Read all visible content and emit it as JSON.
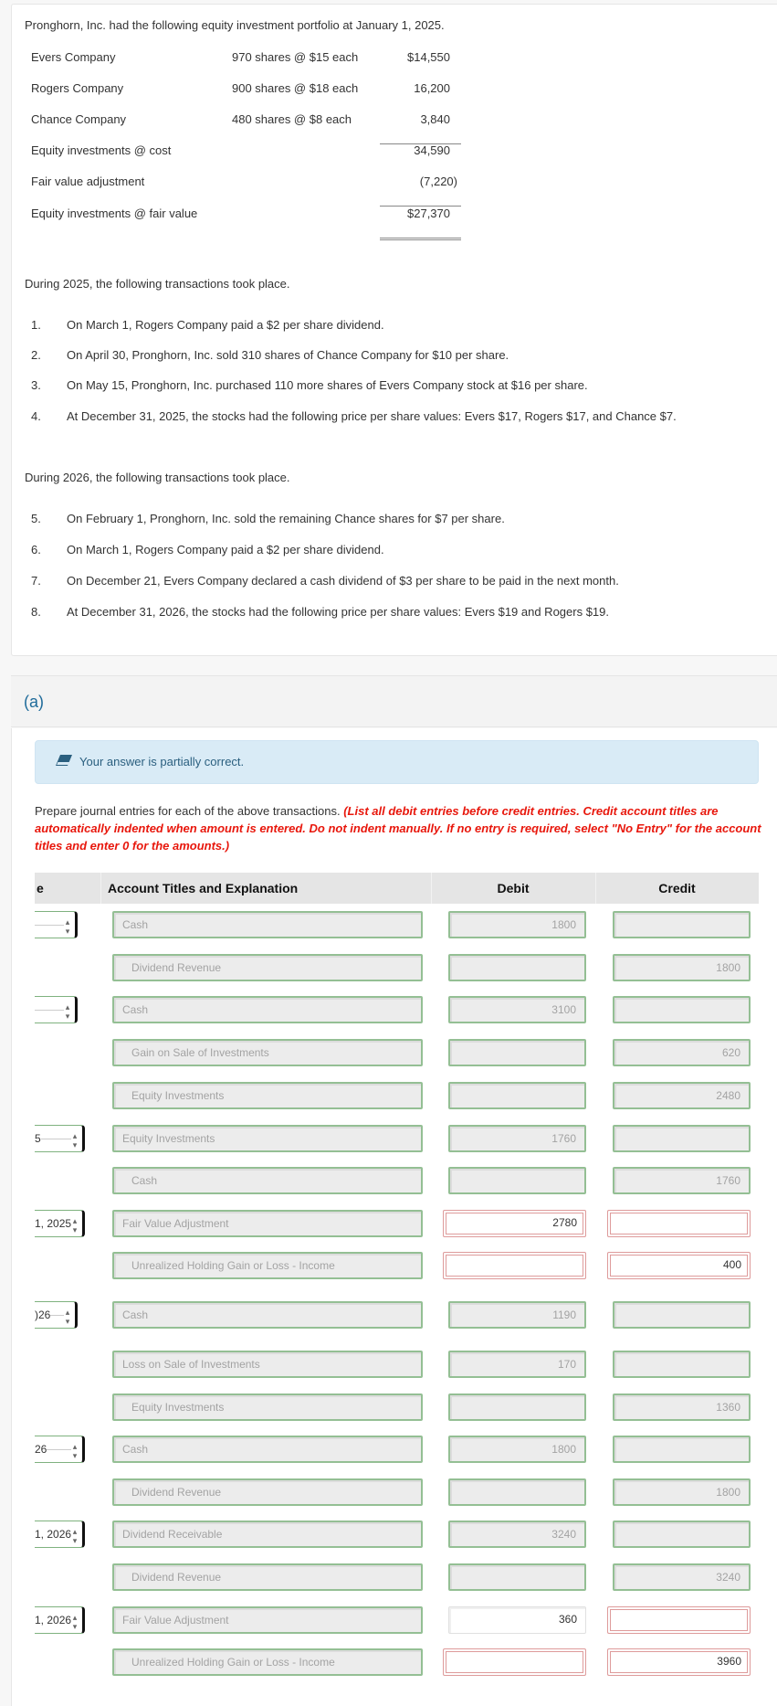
{
  "problem": {
    "intro": "Pronghorn, Inc. had the following equity investment portfolio at January 1, 2025.",
    "portfolio": [
      {
        "name": "Evers Company",
        "shares": "970 shares @ $15 each",
        "amount": "$14,550"
      },
      {
        "name": "Rogers Company",
        "shares": "900 shares @ $18 each",
        "amount": "16,200"
      },
      {
        "name": "Chance Company",
        "shares": "480 shares @ $8 each",
        "amount": "3,840"
      },
      {
        "name": "Equity investments @ cost",
        "shares": "",
        "amount": "34,590"
      },
      {
        "name": "Fair value adjustment",
        "shares": "",
        "amount": "(7,220)"
      },
      {
        "name": "Equity investments @ fair value",
        "shares": "",
        "amount": "$27,370"
      }
    ],
    "year1_heading": "During 2025, the following transactions took place.",
    "year1_items": [
      {
        "num": "1.",
        "text": "On March 1, Rogers Company paid a $2 per share dividend."
      },
      {
        "num": "2.",
        "text": "On April 30, Pronghorn, Inc. sold 310 shares of Chance Company for $10 per share."
      },
      {
        "num": "3.",
        "text": "On May 15, Pronghorn, Inc. purchased 110 more shares of Evers Company stock at $16 per share."
      },
      {
        "num": "4.",
        "text": "At December 31, 2025, the stocks had the following price per share values: Evers $17, Rogers $17, and Chance $7."
      }
    ],
    "year2_heading": "During 2026, the following transactions took place.",
    "year2_items": [
      {
        "num": "5.",
        "text": "On February 1, Pronghorn, Inc. sold the remaining Chance shares for $7 per share."
      },
      {
        "num": "6.",
        "text": "On March 1, Rogers Company paid a $2 per share dividend."
      },
      {
        "num": "7.",
        "text": "On December 21, Evers Company declared a cash dividend of $3 per share to be paid in the next month."
      },
      {
        "num": "8.",
        "text": "At December 31, 2026, the stocks had the following price per share values: Evers $19 and Rogers $19."
      }
    ]
  },
  "part": {
    "label": "(a)",
    "feedback": "Your answer is partially correct.",
    "feedback_icon": "eraser-icon",
    "instructions_plain": "Prepare journal entries for each of the above transactions. ",
    "instructions_red": "(List all debit entries before credit entries. Credit account titles are automatically indented when amount is entered. Do not indent manually. If no entry is required, select \"No Entry\" for the account titles and enter 0 for the amounts.)"
  },
  "table": {
    "headers": {
      "date": "e",
      "account": "Account Titles and Explanation",
      "debit": "Debit",
      "credit": "Credit"
    },
    "rows": [
      {
        "date": "",
        "account": "Cash",
        "debit": "1800",
        "credit": "",
        "indent": false,
        "status": "correct"
      },
      {
        "date": null,
        "account": "Dividend Revenue",
        "debit": "",
        "credit": "1800",
        "indent": true,
        "status": "correct"
      },
      {
        "date": "",
        "account": "Cash",
        "debit": "3100",
        "credit": "",
        "indent": false,
        "status": "correct"
      },
      {
        "date": null,
        "account": "Gain on Sale of Investments",
        "debit": "",
        "credit": "620",
        "indent": true,
        "status": "correct"
      },
      {
        "date": null,
        "account": "Equity Investments",
        "debit": "",
        "credit": "2480",
        "indent": true,
        "status": "correct"
      },
      {
        "date": "5",
        "account": "Equity Investments",
        "debit": "1760",
        "credit": "",
        "indent": false,
        "status": "correct"
      },
      {
        "date": null,
        "account": "Cash",
        "debit": "",
        "credit": "1760",
        "indent": true,
        "status": "correct"
      },
      {
        "date": "1, 2025",
        "account": "Fair Value Adjustment",
        "debit": "2780",
        "credit": "",
        "indent": false,
        "status": "incorrect"
      },
      {
        "date": null,
        "account": "Unrealized Holding Gain or Loss - Income",
        "debit": "",
        "credit": "400",
        "indent": true,
        "status": "incorrect"
      },
      {
        "date": ")26",
        "account": "Cash",
        "debit": "1190",
        "credit": "",
        "indent": false,
        "status": "correct"
      },
      {
        "date": null,
        "account": "Loss on Sale of Investments",
        "debit": "170",
        "credit": "",
        "indent": false,
        "status": "correct"
      },
      {
        "date": null,
        "account": "Equity Investments",
        "debit": "",
        "credit": "1360",
        "indent": true,
        "status": "correct"
      },
      {
        "date": "26",
        "account": "Cash",
        "debit": "1800",
        "credit": "",
        "indent": false,
        "status": "correct"
      },
      {
        "date": null,
        "account": "Dividend Revenue",
        "debit": "",
        "credit": "1800",
        "indent": true,
        "status": "correct"
      },
      {
        "date": "1, 2026",
        "account": "Dividend Receivable",
        "debit": "3240",
        "credit": "",
        "indent": false,
        "status": "correct"
      },
      {
        "date": null,
        "account": "Dividend Revenue",
        "debit": "",
        "credit": "3240",
        "indent": true,
        "status": "correct"
      },
      {
        "date": "1, 2026",
        "account": "Fair Value Adjustment",
        "debit": "360",
        "credit": "",
        "indent": false,
        "status": "mixed-debit-plain"
      },
      {
        "date": null,
        "account": "Unrealized Holding Gain or Loss - Income",
        "debit": "",
        "credit": "3960",
        "indent": true,
        "status": "incorrect"
      }
    ]
  },
  "colors": {
    "correct_border": "#94bf94",
    "incorrect_border": "#de9b9b",
    "banner_bg": "#d9ebf6",
    "banner_text": "#2a5f7f",
    "instruction_red": "#e8170c",
    "part_label": "#1f6b9a"
  }
}
